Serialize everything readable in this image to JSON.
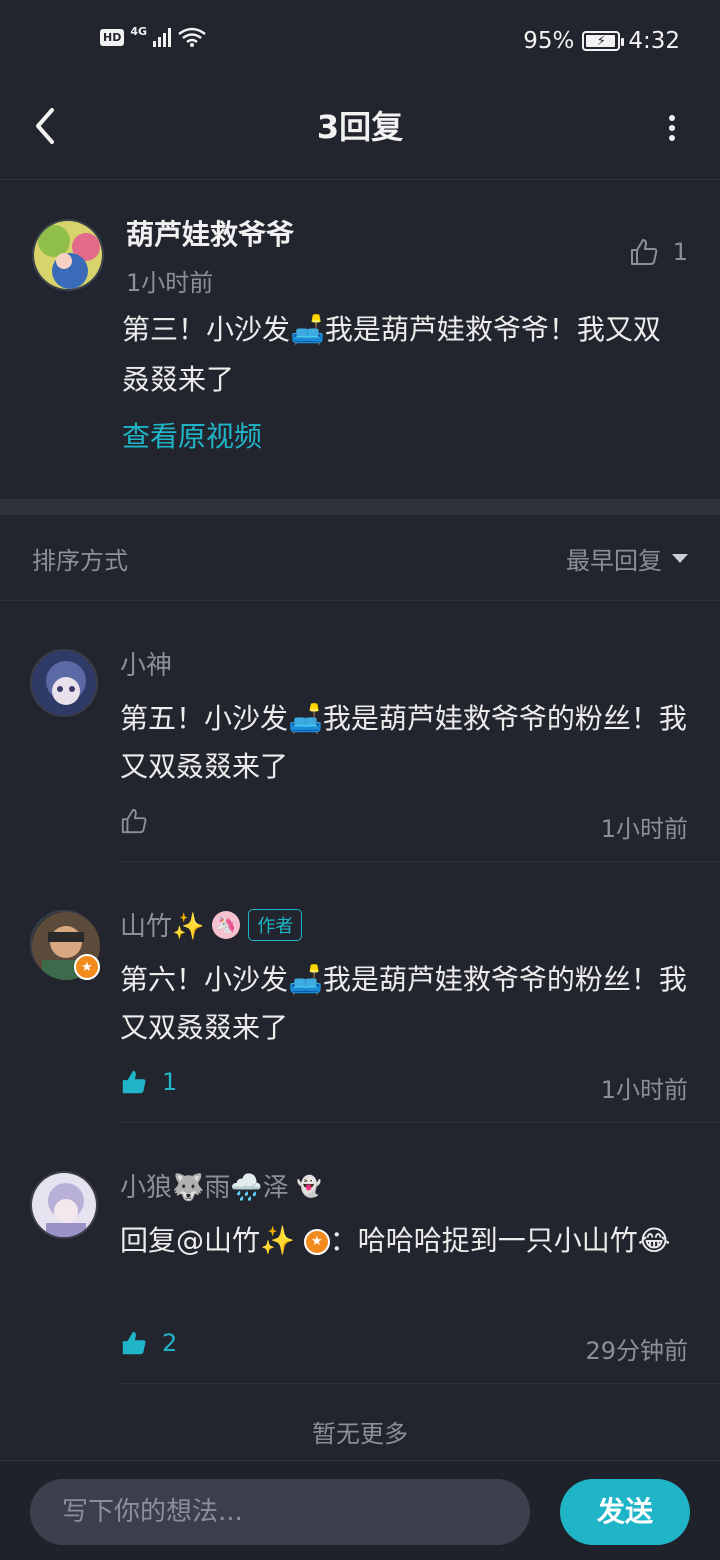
{
  "status_bar": {
    "hd": "HD",
    "network": "4G",
    "battery_pct": "95%",
    "time": "4:32"
  },
  "nav": {
    "title": "3回复"
  },
  "main_comment": {
    "author": "葫芦娃救爷爷",
    "time": "1小时前",
    "like_count": "1",
    "text": "第三！小沙发🛋️我是葫芦娃救爷爷！我又双叒叕来了",
    "link": "查看原视频"
  },
  "sort": {
    "label": "排序方式",
    "value": "最早回复"
  },
  "replies": [
    {
      "author": "小神",
      "text": "第五！小沙发🛋️我是葫芦娃救爷爷的粉丝！我又双叒叕来了",
      "likes": "",
      "time": "1小时前",
      "liked": false
    },
    {
      "author": "山竹✨",
      "author_tag": "作者",
      "text": "第六！小沙发🛋️我是葫芦娃救爷爷的粉丝！我又双叒叕来了",
      "likes": "1",
      "time": "1小时前",
      "liked": true
    },
    {
      "author": "小狼🐺雨🌧️泽",
      "text_prefix": "回复@山竹✨",
      "text": "：哈哈哈捉到一只小山竹😂",
      "likes": "2",
      "time": "29分钟前",
      "liked": true
    }
  ],
  "footer": {
    "no_more": "暂无更多",
    "input_placeholder": "写下你的想法...",
    "send_label": "发送"
  },
  "colors": {
    "background": "#22252e",
    "accent": "#1fb4c8",
    "muted_text": "#8a8f99"
  }
}
